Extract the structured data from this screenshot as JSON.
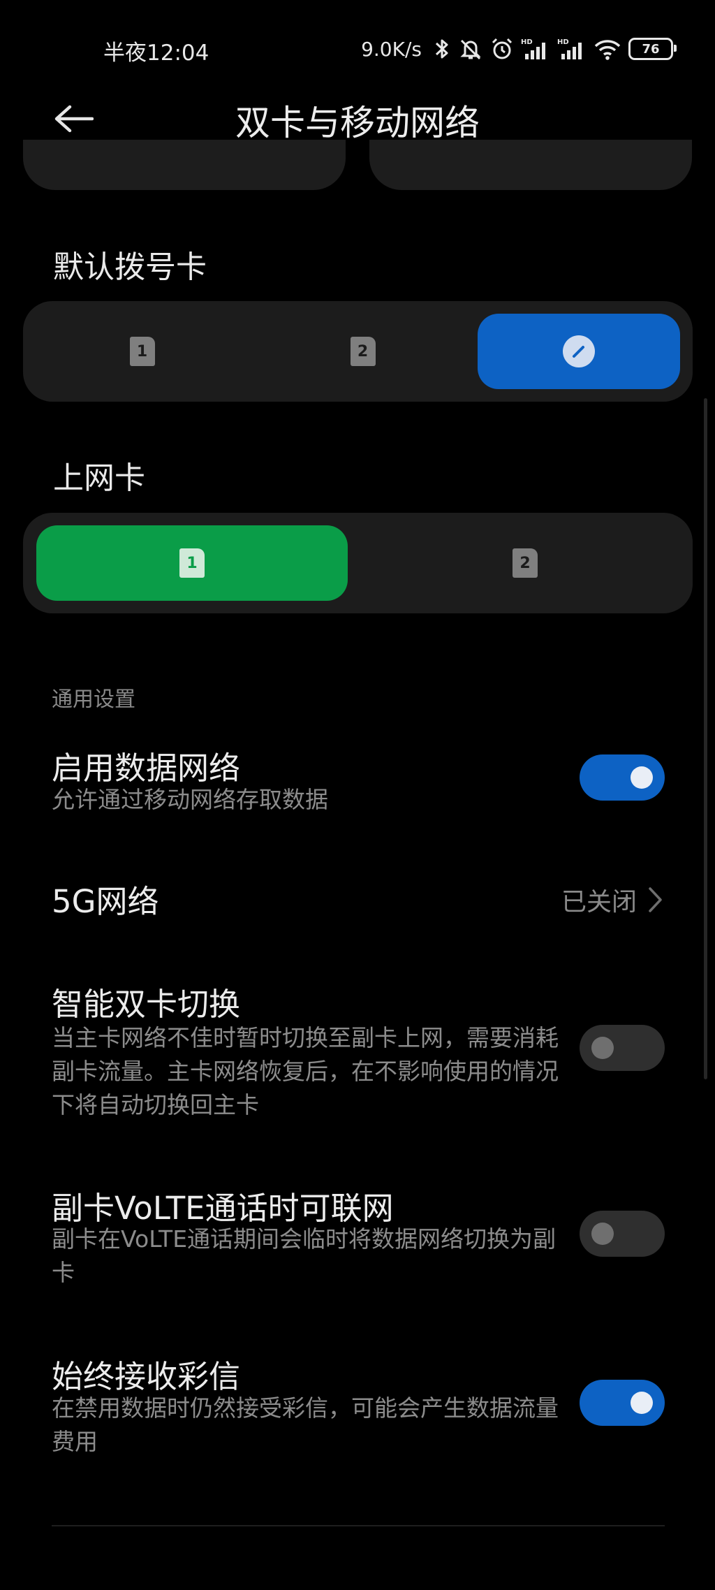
{
  "status_bar": {
    "time": "半夜12:04",
    "speed": "9.0K/s",
    "battery": "76"
  },
  "header": {
    "title": "双卡与移动网络"
  },
  "default_dial": {
    "label": "默认拨号卡",
    "options": [
      "1",
      "2"
    ],
    "selected": "edit"
  },
  "data_sim": {
    "label": "上网卡",
    "options": [
      "1",
      "2"
    ],
    "selected": "1"
  },
  "general": {
    "label": "通用设置",
    "rows": [
      {
        "title": "启用数据网络",
        "subtitle": "允许通过移动网络存取数据",
        "state": "on"
      },
      {
        "title": "5G网络",
        "value": "已关闭"
      },
      {
        "title": "智能双卡切换",
        "subtitle": "当主卡网络不佳时暂时切换至副卡上网，需要消耗副卡流量。主卡网络恢复后，在不影响使用的情况下将自动切换回主卡",
        "state": "off"
      },
      {
        "title": "副卡VoLTE通话时可联网",
        "subtitle": "副卡在VoLTE通话期间会临时将数据网络切换为副卡",
        "state": "off"
      },
      {
        "title": "始终接收彩信",
        "subtitle": "在禁用数据时仍然接受彩信，可能会产生数据流量费用",
        "state": "on"
      }
    ]
  },
  "colors": {
    "accent_blue": "#0d62c4",
    "accent_green": "#0a9d48",
    "background": "#000000",
    "card": "#1c1c1c"
  }
}
